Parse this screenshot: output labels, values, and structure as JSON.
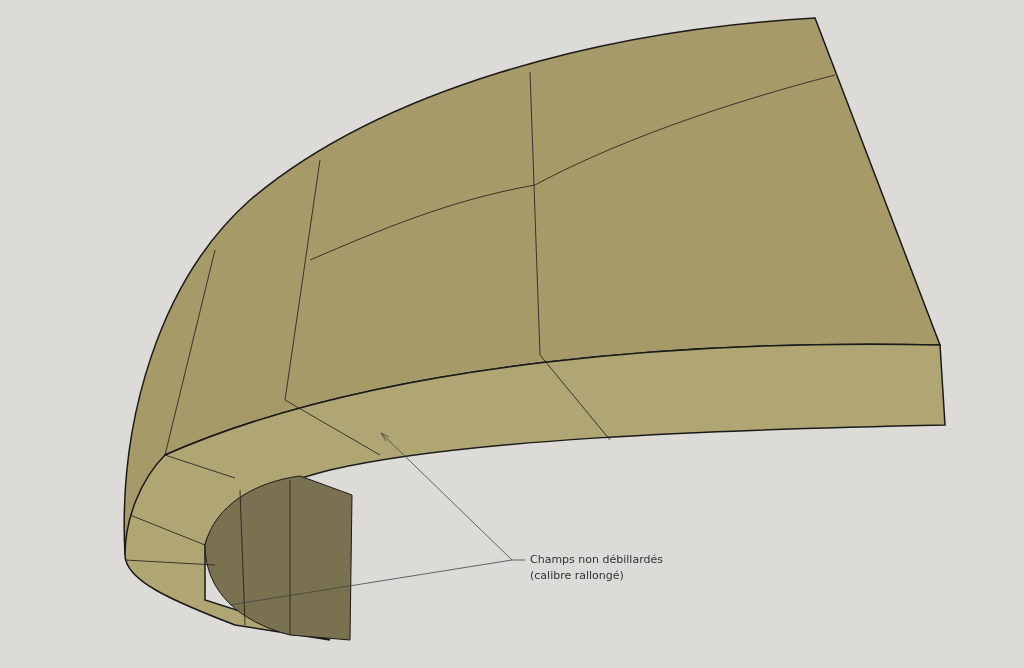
{
  "viewport": {
    "callout": {
      "lines": [
        "Champs non débillardés",
        "(calibre rallongé)"
      ]
    }
  }
}
